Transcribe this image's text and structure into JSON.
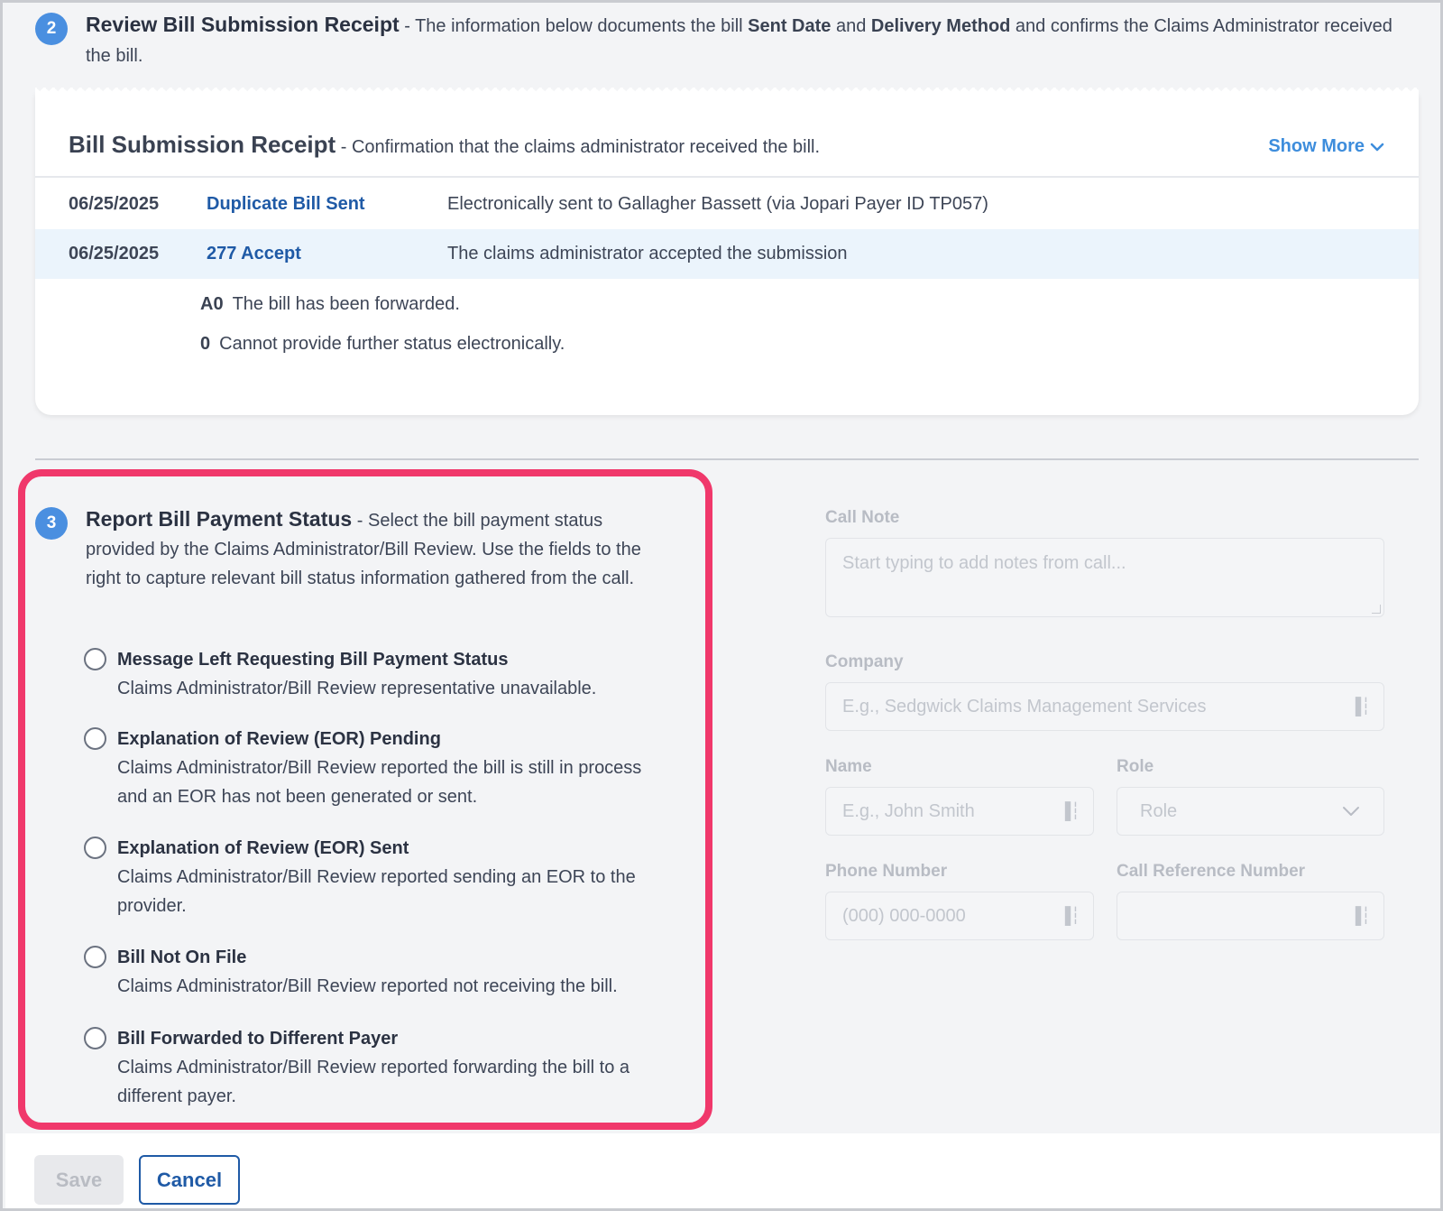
{
  "step2": {
    "number": "2",
    "title": "Review Bill Submission Receipt",
    "text_pre": " - The information below documents the bill ",
    "bold1": "Sent Date",
    "text_mid": " and ",
    "bold2": "Delivery Method",
    "text_post": " and confirms the Claims Administrator received the bill."
  },
  "receipt": {
    "title": "Bill Submission Receipt",
    "subtitle": " - Confirmation that the claims administrator received the bill.",
    "show_more": "Show More",
    "rows": [
      {
        "date": "06/25/2025",
        "status": "Duplicate Bill Sent",
        "description": "Electronically sent to Gallagher Bassett (via Jopari Payer ID TP057)"
      },
      {
        "date": "06/25/2025",
        "status": "277 Accept",
        "description": "The claims administrator accepted the submission"
      }
    ],
    "codes": [
      {
        "code": "A0",
        "text": "The bill has been forwarded."
      },
      {
        "code": "0",
        "text": "Cannot provide further status electronically."
      }
    ]
  },
  "step3": {
    "number": "3",
    "title": "Report Bill Payment Status",
    "description": " - Select the bill payment status provided by the Claims Administrator/Bill Review. Use the fields to the right to capture relevant bill status information gathered from the call.",
    "options": [
      {
        "label": "Message Left Requesting Bill Payment Status",
        "description": "Claims Administrator/Bill Review representative unavailable."
      },
      {
        "label": "Explanation of Review (EOR) Pending",
        "description": "Claims Administrator/Bill Review reported the bill is still in process and an EOR has not been generated or sent."
      },
      {
        "label": "Explanation of Review (EOR) Sent",
        "description": "Claims Administrator/Bill Review reported sending an EOR to the provider."
      },
      {
        "label": "Bill Not On File",
        "description": "Claims Administrator/Bill Review reported not receiving the bill."
      },
      {
        "label": "Bill Forwarded to Different Payer",
        "description": "Claims Administrator/Bill Review reported forwarding the bill to a different payer."
      }
    ]
  },
  "form": {
    "call_note_label": "Call Note",
    "call_note_placeholder": "Start typing to add notes from call...",
    "company_label": "Company",
    "company_placeholder": "E.g., Sedgwick Claims Management Services",
    "name_label": "Name",
    "name_placeholder": "E.g., John Smith",
    "role_label": "Role",
    "role_value": "Role",
    "phone_label": "Phone Number",
    "phone_placeholder": "(000) 000-0000",
    "callref_label": "Call Reference Number",
    "callref_value": ""
  },
  "footer": {
    "save_label": "Save",
    "cancel_label": "Cancel"
  },
  "colors": {
    "accent": "#4a8fe0",
    "link": "#1f5aa6",
    "highlight_border": "#f0386b",
    "row_highlight": "#ebf4fc"
  },
  "icons": {
    "show_more": "chevron-down-icon",
    "field_action": "password-manager-icon",
    "role_select": "chevron-down-icon"
  }
}
